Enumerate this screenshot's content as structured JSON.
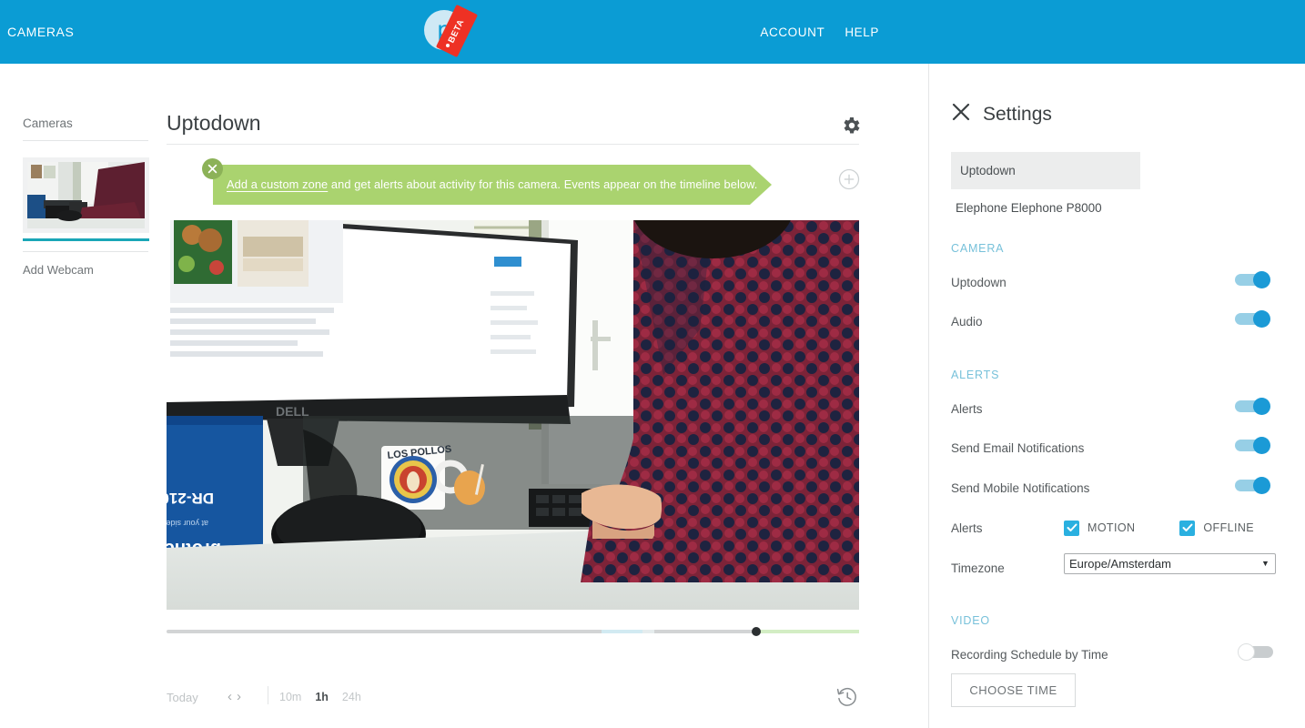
{
  "topbar": {
    "cameras_label": "CAMERAS",
    "account_label": "ACCOUNT",
    "help_label": "HELP",
    "logo_letter": "p",
    "beta_label": "BETA",
    "bg_color": "#0b9cd4"
  },
  "sidebar": {
    "title": "Cameras",
    "add_webcam_label": "Add Webcam",
    "selected_accent": "#1aa6b7"
  },
  "main": {
    "camera_title": "Uptodown",
    "banner": {
      "link_text": "Add a custom zone",
      "rest_text": " and get alerts about activity for this camera. Events appear on the timeline below.",
      "bg_color": "#aad36f"
    },
    "timeline": {
      "today_label": "Today",
      "prev_label": "‹",
      "next_label": "›",
      "zoom_10m": "10m",
      "zoom_1h": "1h",
      "zoom_24h": "24h",
      "active_zoom": "1h"
    }
  },
  "settings": {
    "title": "Settings",
    "cameras": [
      {
        "name": "Uptodown",
        "selected": true
      },
      {
        "name": "Elephone Elephone P8000",
        "selected": false
      }
    ],
    "camera_section": {
      "heading": "CAMERA",
      "rows": [
        {
          "label": "Uptodown",
          "on": true
        },
        {
          "label": "Audio",
          "on": true
        }
      ]
    },
    "alerts_section": {
      "heading": "ALERTS",
      "rows": [
        {
          "label": "Alerts",
          "on": true
        },
        {
          "label": "Send Email Notifications",
          "on": true
        },
        {
          "label": "Send Mobile Notifications",
          "on": true
        }
      ],
      "alerts_types_label": "Alerts",
      "motion_label": "MOTION",
      "motion_checked": true,
      "offline_label": "OFFLINE",
      "offline_checked": true,
      "timezone_label": "Timezone",
      "timezone_value": "Europe/Amsterdam"
    },
    "video_section": {
      "heading": "VIDEO",
      "schedule_label": "Recording Schedule by Time",
      "schedule_on": false,
      "choose_time_label": "CHOOSE TIME"
    },
    "accent_color": "#1b9ad6",
    "section_heading_color": "#77c1da"
  }
}
